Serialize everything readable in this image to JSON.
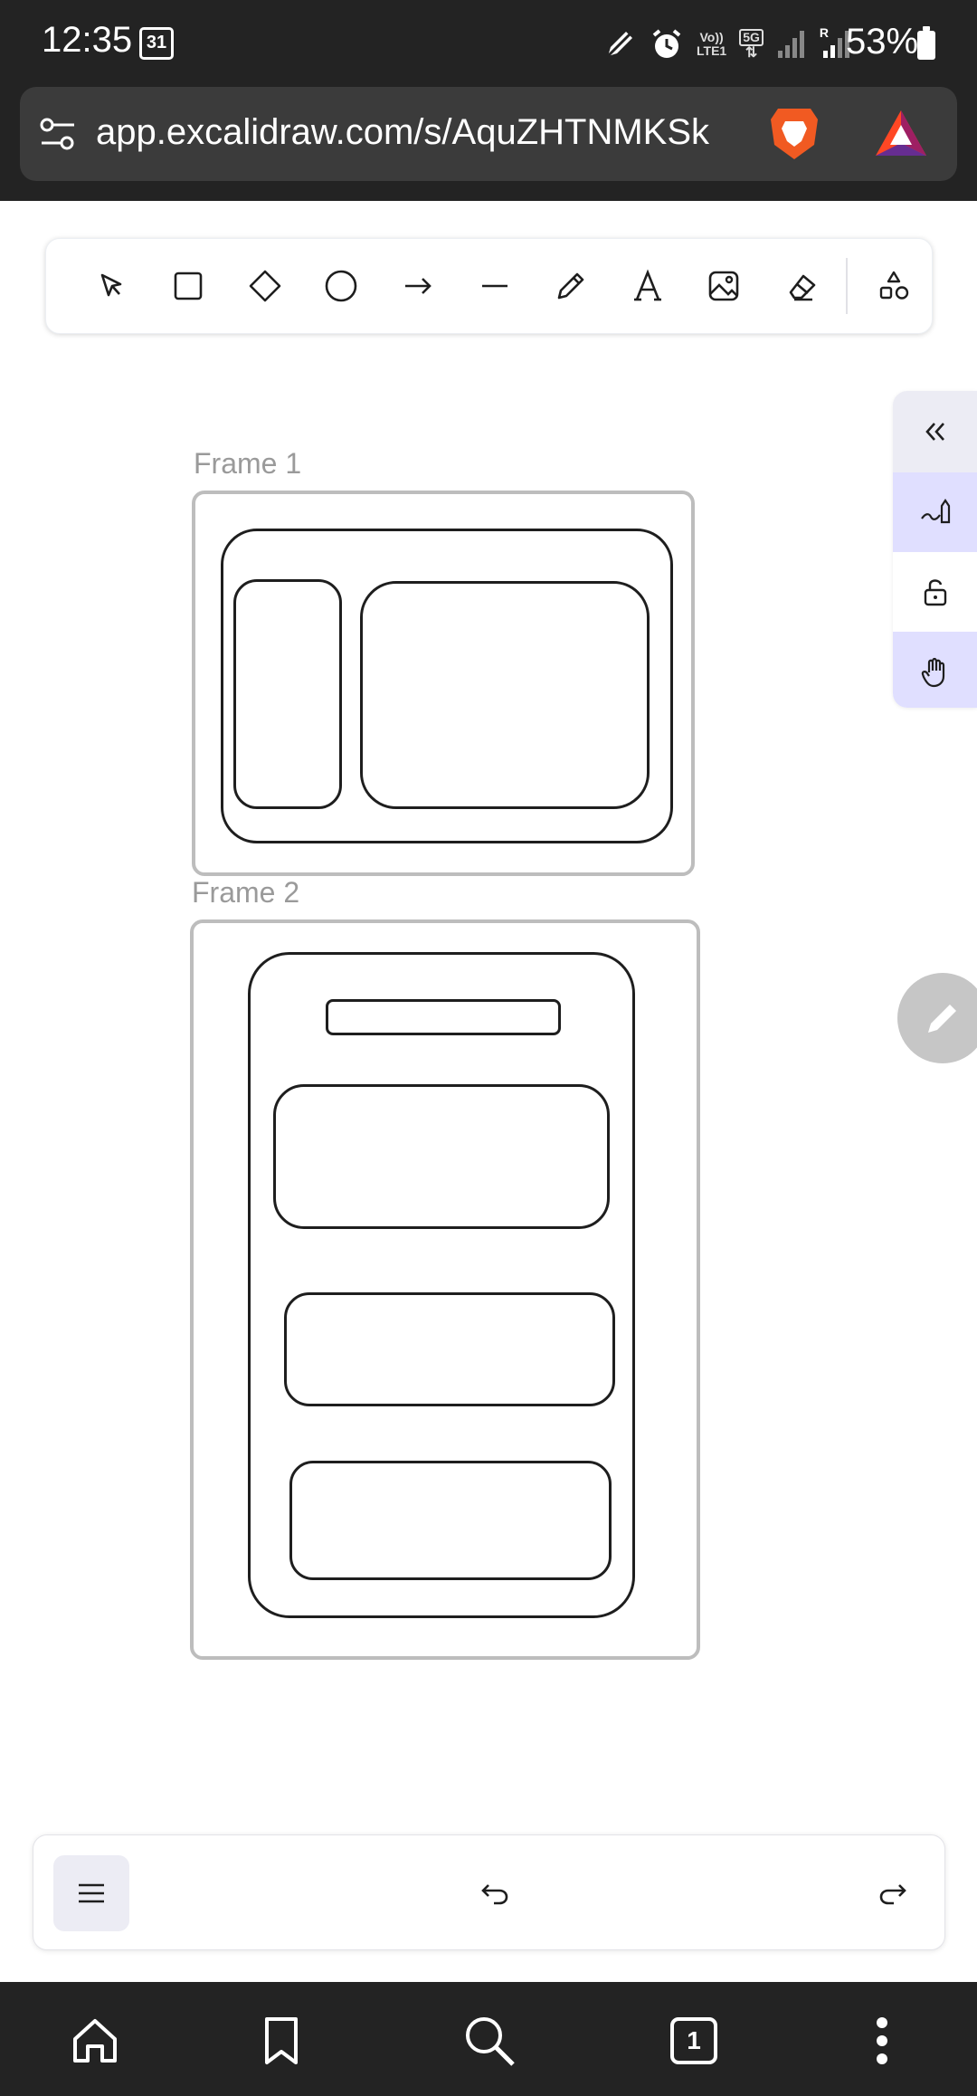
{
  "status_bar": {
    "time": "12:35",
    "calendar_badge": "31",
    "volte_label_top": "Vo))",
    "volte_label_bottom": "LTE1",
    "network_label": "5G",
    "roaming_label": "R",
    "battery_percent": "53%"
  },
  "browser": {
    "url": "app.excalidraw.com/s/AquZHTNMKSk",
    "tab_count": "1"
  },
  "toolbar": {
    "tools": [
      "selection-icon",
      "rectangle-icon",
      "diamond-icon",
      "ellipse-icon",
      "arrow-icon",
      "line-icon",
      "pencil-icon",
      "text-icon",
      "image-icon",
      "eraser-icon",
      "more-shapes-icon"
    ],
    "selected_tool": null
  },
  "canvas": {
    "frames": [
      {
        "label": "Frame 1"
      },
      {
        "label": "Frame 2"
      }
    ]
  },
  "side_panel": {
    "buttons": [
      "collapse-icon",
      "pen-mode-icon",
      "lock-icon",
      "hand-icon"
    ]
  },
  "colors": {
    "accent": "#e0dfff",
    "chrome_dark": "#232323",
    "frame_border": "#bdbdbd",
    "stroke": "#1e1e1e"
  }
}
